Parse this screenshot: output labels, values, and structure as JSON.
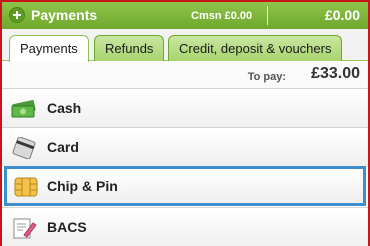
{
  "header": {
    "title": "Payments",
    "commission": "Cmsn £0.00",
    "total": "£0.00"
  },
  "tabs": [
    {
      "label": "Payments",
      "active": true
    },
    {
      "label": "Refunds",
      "active": false
    },
    {
      "label": "Credit, deposit & vouchers",
      "active": false
    }
  ],
  "to_pay": {
    "label": "To pay:",
    "amount": "£33.00"
  },
  "methods": [
    {
      "label": "Cash",
      "icon": "cash-icon"
    },
    {
      "label": "Card",
      "icon": "card-icon"
    },
    {
      "label": "Chip & Pin",
      "icon": "chip-pin-icon",
      "selected": true
    },
    {
      "label": "BACS",
      "icon": "bacs-icon"
    }
  ],
  "colors": {
    "header_green": "#7ab536",
    "panel_border": "#c8141c",
    "selection_blue": "#3d8fd0"
  }
}
